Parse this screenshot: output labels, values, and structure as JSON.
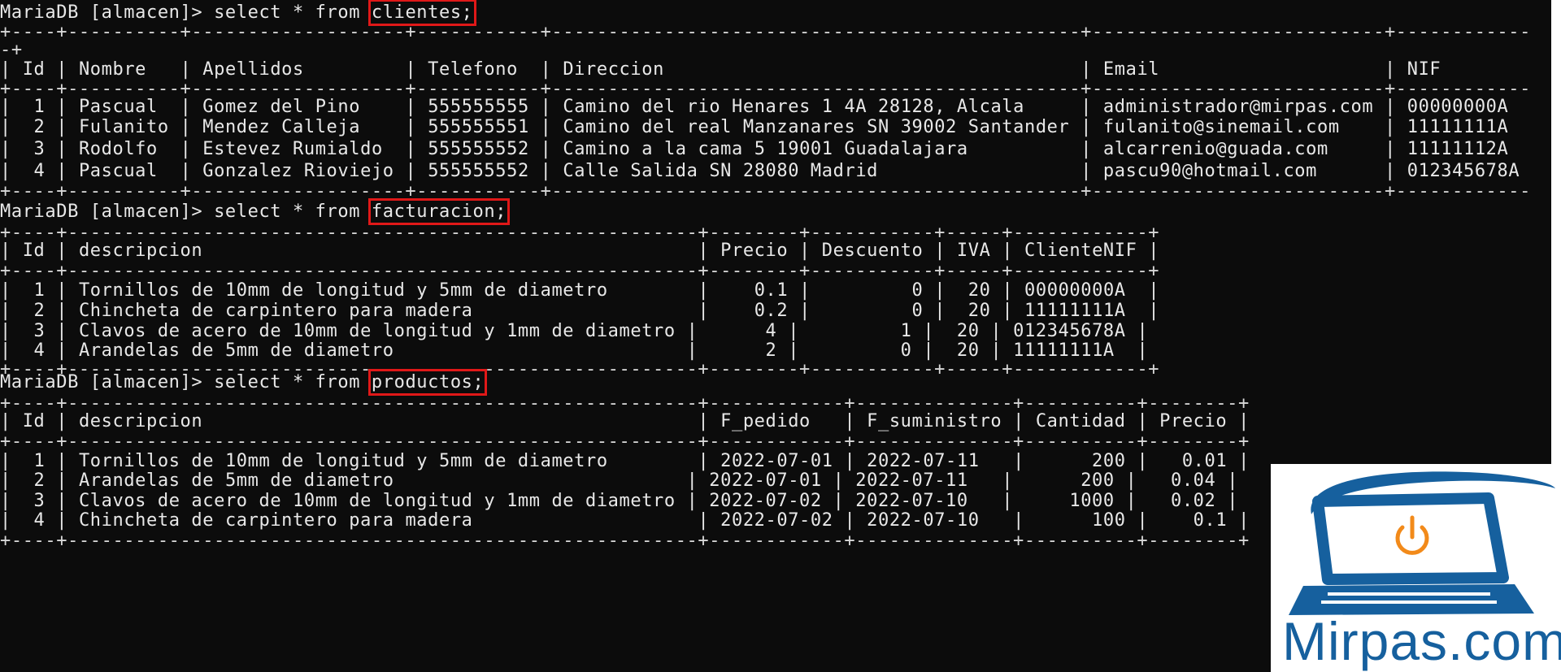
{
  "prompt": "MariaDB [almacen]> ",
  "query_prefix": "select * from ",
  "queries": [
    {
      "table": "clientes;"
    },
    {
      "table": "facturacion;"
    },
    {
      "table": "productos;"
    }
  ],
  "clientes": {
    "headers": [
      "Id",
      "Nombre",
      "Apellidos",
      "Telefono",
      "Direccion",
      "Email",
      "NIF"
    ],
    "rows": [
      [
        "1",
        "Pascual",
        "Gomez del Pino",
        "555555555",
        "Camino del rio Henares 1 4A 28128, Alcala",
        "administrador@mirpas.com",
        "00000000A"
      ],
      [
        "2",
        "Fulanito",
        "Mendez Calleja",
        "555555551",
        "Camino del real Manzanares SN 39002 Santander",
        "fulanito@sinemail.com",
        "11111111A"
      ],
      [
        "3",
        "Rodolfo",
        "Estevez Rumialdo",
        "555555552",
        "Camino a la cama 5 19001 Guadalajara",
        "alcarrenio@guada.com",
        "11111112A"
      ],
      [
        "4",
        "Pascual",
        "Gonzalez Rioviejo",
        "555555552",
        "Calle Salida SN 28080 Madrid",
        "pascu90@hotmail.com",
        "012345678A"
      ]
    ]
  },
  "facturacion": {
    "headers": [
      "Id",
      "descripcion",
      "Precio",
      "Descuento",
      "IVA",
      "ClienteNIF"
    ],
    "rows": [
      [
        "1",
        "Tornillos de 10mm de longitud y 5mm de diametro",
        "0.1",
        "0",
        "20",
        "00000000A"
      ],
      [
        "2",
        "Chincheta de carpintero para madera",
        "0.2",
        "0",
        "20",
        "11111111A"
      ],
      [
        "3",
        "Clavos de acero de 10mm de longitud y 1mm de diametro",
        "4",
        "1",
        "20",
        "012345678A"
      ],
      [
        "4",
        "Arandelas de 5mm de diametro",
        "2",
        "0",
        "20",
        "11111111A"
      ]
    ]
  },
  "productos": {
    "headers": [
      "Id",
      "descripcion",
      "F_pedido",
      "F_suministro",
      "Cantidad",
      "Precio"
    ],
    "rows": [
      [
        "1",
        "Tornillos de 10mm de longitud y 5mm de diametro",
        "2022-07-01",
        "2022-07-11",
        "200",
        "0.01"
      ],
      [
        "2",
        "Arandelas de 5mm de diametro",
        "2022-07-01",
        "2022-07-11",
        "200",
        "0.04"
      ],
      [
        "3",
        "Clavos de acero de 10mm de longitud y 1mm de diametro",
        "2022-07-02",
        "2022-07-10",
        "1000",
        "0.02"
      ],
      [
        "4",
        "Chincheta de carpintero para madera",
        "2022-07-02",
        "2022-07-10",
        "100",
        "0.1"
      ]
    ]
  },
  "logo": {
    "text": "Mirpas.com",
    "icon": "computer-power-icon",
    "colors": {
      "blue": "#16609e",
      "orange": "#f28a1a"
    }
  },
  "colors": {
    "terminal_bg": "#0c0c0c",
    "terminal_fg": "#e8e8e8",
    "highlight": "#e01818"
  }
}
